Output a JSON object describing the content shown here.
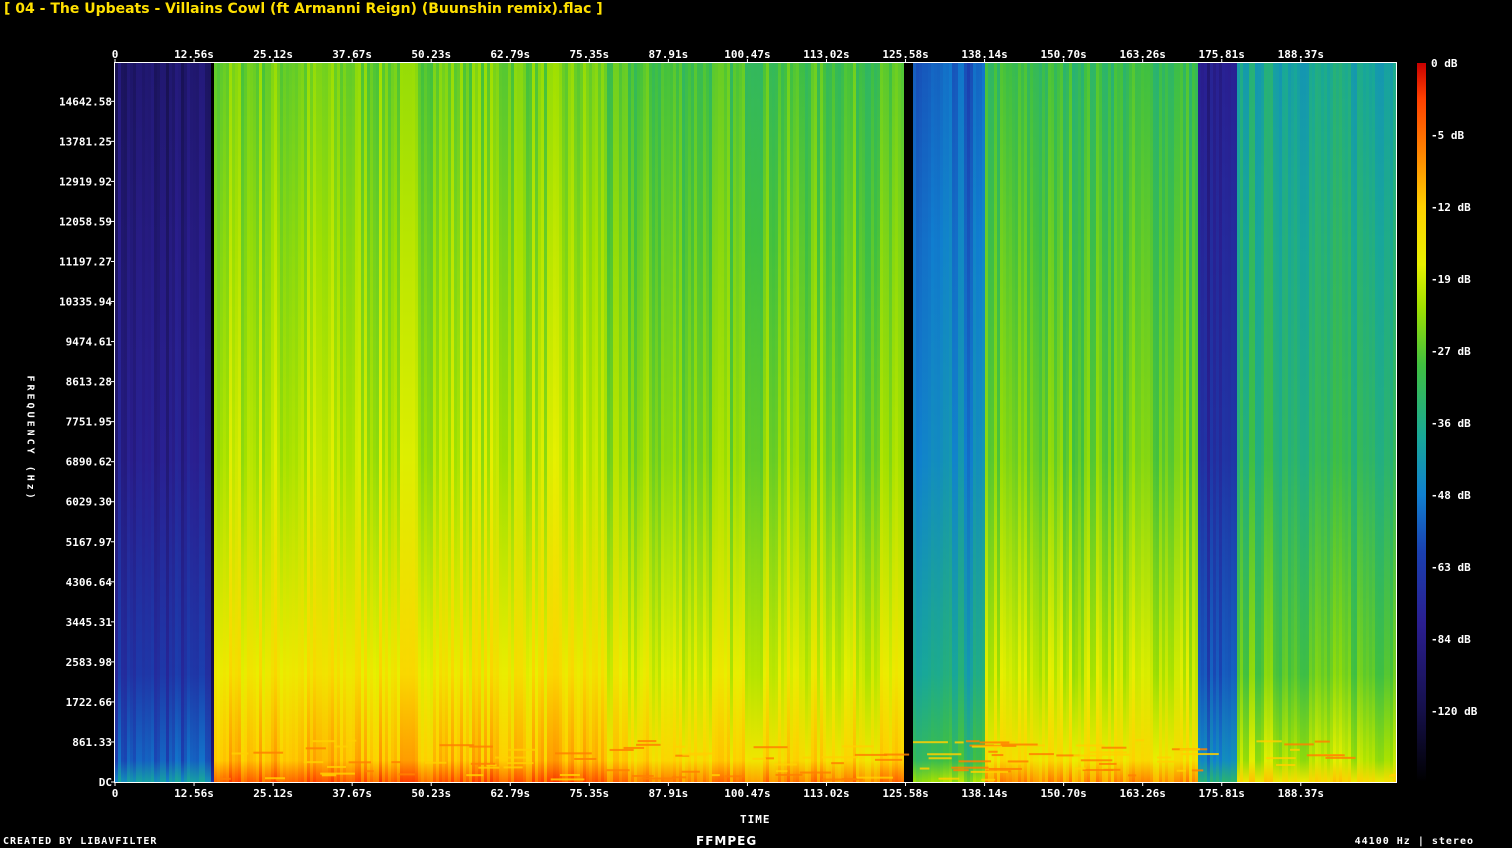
{
  "title": "[ 04 - The Upbeats - Villains Cowl (ft Armanni Reign) (Buunshin remix).flac ]",
  "footer": {
    "created_by": "CREATED BY LIBAVFILTER",
    "logo": "FFMPEG",
    "sample_info": "44100 Hz | stereo"
  },
  "colors": {
    "background": "#000000",
    "title": "#ffe000",
    "axis": "#ffffff"
  },
  "chart_data": {
    "type": "heatmap",
    "title": "[ 04 - The Upbeats - Villains Cowl (ft Armanni Reign) (Buunshin remix).flac ]",
    "xlabel": "TIME",
    "ylabel": "FREQUENCY (Hz)",
    "x_ticks": [
      "0",
      "12.56s",
      "25.12s",
      "37.67s",
      "50.23s",
      "62.79s",
      "75.35s",
      "87.91s",
      "100.47s",
      "113.02s",
      "125.58s",
      "138.14s",
      "150.70s",
      "163.26s",
      "175.81s",
      "188.37s"
    ],
    "y_ticks": [
      "DC",
      "861.33",
      "1722.66",
      "2583.98",
      "3445.31",
      "4306.64",
      "5167.97",
      "6029.30",
      "6890.62",
      "7751.95",
      "8613.28",
      "9474.61",
      "10335.94",
      "11197.27",
      "12058.59",
      "12919.92",
      "13781.25",
      "14642.58"
    ],
    "xlim": [
      0,
      203.5
    ],
    "ylim": [
      0,
      15500
    ],
    "colorbar_labels": [
      "0 dB",
      "-5 dB",
      "-12 dB",
      "-19 dB",
      "-27 dB",
      "-36 dB",
      "-48 dB",
      "-63 dB",
      "-84 dB",
      "-120 dB"
    ],
    "colorscale": [
      "#c80000",
      "#ff4000",
      "#ff8000",
      "#ffd000",
      "#e8f000",
      "#a0e000",
      "#40c040",
      "#18a898",
      "#1080d0",
      "#1a40b0",
      "#2a1e90",
      "#15104a",
      "#000000"
    ],
    "energy_profile": [
      {
        "t": [
          0,
          15.2
        ],
        "level": 0.25
      },
      {
        "t": [
          15.2,
          15.6
        ],
        "level": 0.05
      },
      {
        "t": [
          15.6,
          78
        ],
        "level": 0.72
      },
      {
        "t": [
          78,
          125
        ],
        "level": 0.68
      },
      {
        "t": [
          125,
          126.5
        ],
        "level": 0.0
      },
      {
        "t": [
          126.5,
          138
        ],
        "level": 0.45
      },
      {
        "t": [
          138,
          172
        ],
        "level": 0.66
      },
      {
        "t": [
          172,
          178
        ],
        "level": 0.3
      },
      {
        "t": [
          178,
          203.5
        ],
        "level": 0.58
      }
    ]
  }
}
